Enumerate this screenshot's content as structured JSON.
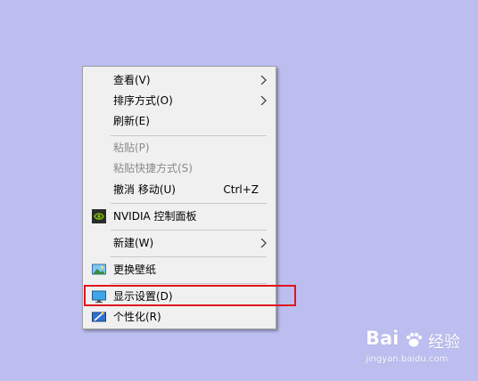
{
  "menu": {
    "items": [
      {
        "label": "查看(V)",
        "submenu": true,
        "enabled": true
      },
      {
        "label": "排序方式(O)",
        "submenu": true,
        "enabled": true
      },
      {
        "label": "刷新(E)",
        "enabled": true
      },
      {
        "label": "粘贴(P)",
        "enabled": false
      },
      {
        "label": "粘贴快捷方式(S)",
        "enabled": false
      },
      {
        "label": "撤消 移动(U)",
        "shortcut": "Ctrl+Z",
        "enabled": true
      },
      {
        "label": "NVIDIA 控制面板",
        "icon": "nvidia-icon",
        "enabled": true
      },
      {
        "label": "新建(W)",
        "submenu": true,
        "enabled": true
      },
      {
        "label": "更换壁纸",
        "icon": "wallpaper-icon",
        "enabled": true
      },
      {
        "label": "显示设置(D)",
        "icon": "monitor-icon",
        "enabled": true,
        "highlighted": true
      },
      {
        "label": "个性化(R)",
        "icon": "personalize-icon",
        "enabled": true
      }
    ]
  },
  "watermark": {
    "brand": "Bai",
    "suffix": "经验",
    "url": "jingyan.baidu.com"
  },
  "colors": {
    "desktop_background": "#bcbef0",
    "menu_background": "#f0f0f0",
    "highlight_border": "#e0141e",
    "disabled_text": "#8a8a8a"
  }
}
